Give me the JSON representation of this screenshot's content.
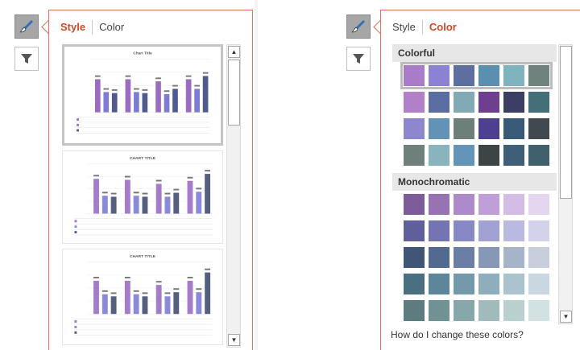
{
  "left_panel": {
    "tabs": {
      "style": "Style",
      "color": "Color",
      "selected": "style"
    },
    "icons": {
      "style_button": "paintbrush-icon",
      "filter_button": "filter-icon"
    },
    "thumbnails": [
      {
        "title": "Chart Title",
        "bars": [
          [
            62,
            38,
            36
          ],
          [
            62,
            38,
            36
          ],
          [
            58,
            34,
            44
          ],
          [
            62,
            44,
            68
          ]
        ],
        "colors": [
          "#9b6bbf",
          "#7c7cd4",
          "#4f5b8f"
        ],
        "selected": true
      },
      {
        "title": "CHART TITLE",
        "bars": [
          [
            70,
            36,
            34
          ],
          [
            68,
            36,
            34
          ],
          [
            60,
            34,
            42
          ],
          [
            66,
            44,
            80
          ]
        ],
        "colors": [
          "#a57cc9",
          "#8a8ad8",
          "#55607f"
        ],
        "selected": false
      },
      {
        "title": "CHART TITLE",
        "bars": [
          [
            64,
            38,
            34
          ],
          [
            64,
            38,
            34
          ],
          [
            56,
            34,
            42
          ],
          [
            64,
            42,
            80
          ]
        ],
        "colors": [
          "#a57cc9",
          "#8a8ad8",
          "#55607f"
        ],
        "selected": false
      }
    ],
    "accent": "#d24726"
  },
  "right_panel": {
    "tabs": {
      "style": "Style",
      "color": "Color",
      "selected": "color"
    },
    "icons": {
      "style_button": "paintbrush-icon",
      "filter_button": "filter-icon"
    },
    "sections": [
      {
        "title": "Colorful",
        "rows": [
          [
            "#a97bc8",
            "#8a82d2",
            "#5d6fa0",
            "#5b8fb0",
            "#7fb3c0",
            "#6f827e"
          ],
          [
            "#b27fc9",
            "#5b6ea2",
            "#82aab6",
            "#6e3f8e",
            "#3a3f63",
            "#436f78"
          ],
          [
            "#8c87cf",
            "#6293b6",
            "#6e7f7a",
            "#4f3f8f",
            "#395a78",
            "#41494e"
          ],
          [
            "#6f7f7b",
            "#89b3bd",
            "#6494b7",
            "#3d4446",
            "#3f5f78",
            "#41606e"
          ]
        ],
        "selected_row": 0
      },
      {
        "title": "Monochromatic",
        "rows": [
          [
            "#7e5c9a",
            "#9873b4",
            "#ad8bcb",
            "#c09fd8",
            "#d3bce6",
            "#e4d6ef"
          ],
          [
            "#5f5f9b",
            "#7474b3",
            "#8888c7",
            "#a1a1d4",
            "#babae0",
            "#d2d2eb"
          ],
          [
            "#415577",
            "#526a8f",
            "#6a7fa3",
            "#8698b6",
            "#a6b3c8",
            "#c6cfdb"
          ],
          [
            "#4a6f80",
            "#5d869a",
            "#7399ab",
            "#8eaebd",
            "#abc3cf",
            "#c9d8e0"
          ],
          [
            "#5c7c7f",
            "#709295",
            "#88a7aa",
            "#a1bbbd",
            "#bacfd0",
            "#d2e1e1"
          ]
        ]
      }
    ],
    "help_text": "How do I change these colors?"
  }
}
